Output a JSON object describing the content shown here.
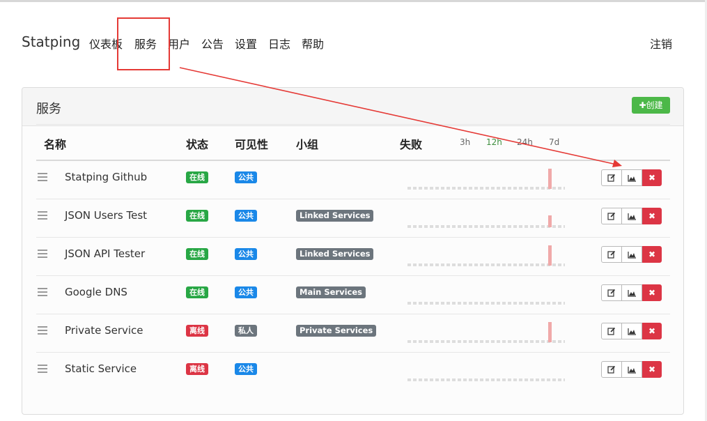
{
  "nav": {
    "brand": "Statping",
    "links": [
      "仪表板",
      "服务",
      "用户",
      "公告",
      "设置",
      "日志",
      "帮助"
    ],
    "logout": "注销"
  },
  "card": {
    "title": "服务",
    "create_label": "创建"
  },
  "table": {
    "headers": {
      "name": "名称",
      "status": "状态",
      "visibility": "可见性",
      "group": "小组",
      "failures": "失败"
    },
    "timeframes": [
      "3h",
      "12h",
      "24h",
      "7d"
    ],
    "active_timeframe": "12h",
    "rows": [
      {
        "name": "Statping Github",
        "status": "在线",
        "status_state": "online",
        "visibility": "公共",
        "visibility_state": "public",
        "group": "",
        "spikes": [
          {
            "pos": 0.88,
            "level": 0.95
          }
        ]
      },
      {
        "name": "JSON Users Test",
        "status": "在线",
        "status_state": "online",
        "visibility": "公共",
        "visibility_state": "public",
        "group": "Linked Services",
        "spikes": [
          {
            "pos": 0.88,
            "level": 0.55
          }
        ]
      },
      {
        "name": "JSON API Tester",
        "status": "在线",
        "status_state": "online",
        "visibility": "公共",
        "visibility_state": "public",
        "group": "Linked Services",
        "spikes": [
          {
            "pos": 0.88,
            "level": 0.95
          }
        ]
      },
      {
        "name": "Google DNS",
        "status": "在线",
        "status_state": "online",
        "visibility": "公共",
        "visibility_state": "public",
        "group": "Main Services",
        "spikes": []
      },
      {
        "name": "Private Service",
        "status": "离线",
        "status_state": "offline",
        "visibility": "私人",
        "visibility_state": "private",
        "group": "Private Services",
        "spikes": [
          {
            "pos": 0.88,
            "level": 0.95
          }
        ]
      },
      {
        "name": "Static Service",
        "status": "离线",
        "status_state": "offline",
        "visibility": "公共",
        "visibility_state": "public",
        "group": "",
        "spikes": []
      }
    ]
  },
  "colors": {
    "online": "#28a745",
    "offline": "#dc3545",
    "public": "#1a88e8",
    "private": "#6c757d",
    "create": "#4cb848",
    "annotation": "#e53935"
  },
  "icons": {
    "create": "plus-icon",
    "edit": "edit-icon",
    "chart": "chart-icon",
    "delete": "close-icon",
    "drag": "drag-handle-icon"
  }
}
